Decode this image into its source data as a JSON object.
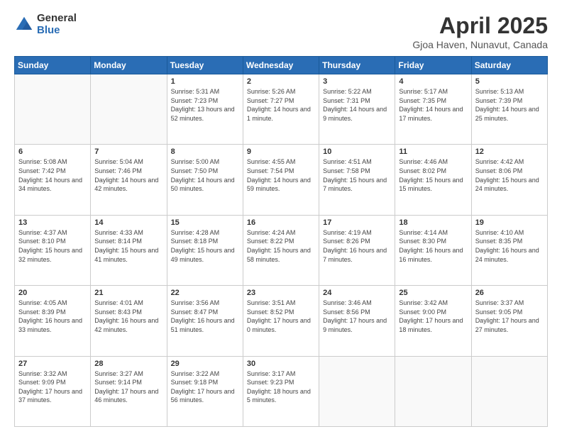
{
  "header": {
    "logo_general": "General",
    "logo_blue": "Blue",
    "title": "April 2025",
    "location": "Gjoa Haven, Nunavut, Canada"
  },
  "days_of_week": [
    "Sunday",
    "Monday",
    "Tuesday",
    "Wednesday",
    "Thursday",
    "Friday",
    "Saturday"
  ],
  "weeks": [
    [
      {
        "day": "",
        "empty": true
      },
      {
        "day": "",
        "empty": true
      },
      {
        "day": "1",
        "sunrise": "Sunrise: 5:31 AM",
        "sunset": "Sunset: 7:23 PM",
        "daylight": "Daylight: 13 hours and 52 minutes."
      },
      {
        "day": "2",
        "sunrise": "Sunrise: 5:26 AM",
        "sunset": "Sunset: 7:27 PM",
        "daylight": "Daylight: 14 hours and 1 minute."
      },
      {
        "day": "3",
        "sunrise": "Sunrise: 5:22 AM",
        "sunset": "Sunset: 7:31 PM",
        "daylight": "Daylight: 14 hours and 9 minutes."
      },
      {
        "day": "4",
        "sunrise": "Sunrise: 5:17 AM",
        "sunset": "Sunset: 7:35 PM",
        "daylight": "Daylight: 14 hours and 17 minutes."
      },
      {
        "day": "5",
        "sunrise": "Sunrise: 5:13 AM",
        "sunset": "Sunset: 7:39 PM",
        "daylight": "Daylight: 14 hours and 25 minutes."
      }
    ],
    [
      {
        "day": "6",
        "sunrise": "Sunrise: 5:08 AM",
        "sunset": "Sunset: 7:42 PM",
        "daylight": "Daylight: 14 hours and 34 minutes."
      },
      {
        "day": "7",
        "sunrise": "Sunrise: 5:04 AM",
        "sunset": "Sunset: 7:46 PM",
        "daylight": "Daylight: 14 hours and 42 minutes."
      },
      {
        "day": "8",
        "sunrise": "Sunrise: 5:00 AM",
        "sunset": "Sunset: 7:50 PM",
        "daylight": "Daylight: 14 hours and 50 minutes."
      },
      {
        "day": "9",
        "sunrise": "Sunrise: 4:55 AM",
        "sunset": "Sunset: 7:54 PM",
        "daylight": "Daylight: 14 hours and 59 minutes."
      },
      {
        "day": "10",
        "sunrise": "Sunrise: 4:51 AM",
        "sunset": "Sunset: 7:58 PM",
        "daylight": "Daylight: 15 hours and 7 minutes."
      },
      {
        "day": "11",
        "sunrise": "Sunrise: 4:46 AM",
        "sunset": "Sunset: 8:02 PM",
        "daylight": "Daylight: 15 hours and 15 minutes."
      },
      {
        "day": "12",
        "sunrise": "Sunrise: 4:42 AM",
        "sunset": "Sunset: 8:06 PM",
        "daylight": "Daylight: 15 hours and 24 minutes."
      }
    ],
    [
      {
        "day": "13",
        "sunrise": "Sunrise: 4:37 AM",
        "sunset": "Sunset: 8:10 PM",
        "daylight": "Daylight: 15 hours and 32 minutes."
      },
      {
        "day": "14",
        "sunrise": "Sunrise: 4:33 AM",
        "sunset": "Sunset: 8:14 PM",
        "daylight": "Daylight: 15 hours and 41 minutes."
      },
      {
        "day": "15",
        "sunrise": "Sunrise: 4:28 AM",
        "sunset": "Sunset: 8:18 PM",
        "daylight": "Daylight: 15 hours and 49 minutes."
      },
      {
        "day": "16",
        "sunrise": "Sunrise: 4:24 AM",
        "sunset": "Sunset: 8:22 PM",
        "daylight": "Daylight: 15 hours and 58 minutes."
      },
      {
        "day": "17",
        "sunrise": "Sunrise: 4:19 AM",
        "sunset": "Sunset: 8:26 PM",
        "daylight": "Daylight: 16 hours and 7 minutes."
      },
      {
        "day": "18",
        "sunrise": "Sunrise: 4:14 AM",
        "sunset": "Sunset: 8:30 PM",
        "daylight": "Daylight: 16 hours and 16 minutes."
      },
      {
        "day": "19",
        "sunrise": "Sunrise: 4:10 AM",
        "sunset": "Sunset: 8:35 PM",
        "daylight": "Daylight: 16 hours and 24 minutes."
      }
    ],
    [
      {
        "day": "20",
        "sunrise": "Sunrise: 4:05 AM",
        "sunset": "Sunset: 8:39 PM",
        "daylight": "Daylight: 16 hours and 33 minutes."
      },
      {
        "day": "21",
        "sunrise": "Sunrise: 4:01 AM",
        "sunset": "Sunset: 8:43 PM",
        "daylight": "Daylight: 16 hours and 42 minutes."
      },
      {
        "day": "22",
        "sunrise": "Sunrise: 3:56 AM",
        "sunset": "Sunset: 8:47 PM",
        "daylight": "Daylight: 16 hours and 51 minutes."
      },
      {
        "day": "23",
        "sunrise": "Sunrise: 3:51 AM",
        "sunset": "Sunset: 8:52 PM",
        "daylight": "Daylight: 17 hours and 0 minutes."
      },
      {
        "day": "24",
        "sunrise": "Sunrise: 3:46 AM",
        "sunset": "Sunset: 8:56 PM",
        "daylight": "Daylight: 17 hours and 9 minutes."
      },
      {
        "day": "25",
        "sunrise": "Sunrise: 3:42 AM",
        "sunset": "Sunset: 9:00 PM",
        "daylight": "Daylight: 17 hours and 18 minutes."
      },
      {
        "day": "26",
        "sunrise": "Sunrise: 3:37 AM",
        "sunset": "Sunset: 9:05 PM",
        "daylight": "Daylight: 17 hours and 27 minutes."
      }
    ],
    [
      {
        "day": "27",
        "sunrise": "Sunrise: 3:32 AM",
        "sunset": "Sunset: 9:09 PM",
        "daylight": "Daylight: 17 hours and 37 minutes."
      },
      {
        "day": "28",
        "sunrise": "Sunrise: 3:27 AM",
        "sunset": "Sunset: 9:14 PM",
        "daylight": "Daylight: 17 hours and 46 minutes."
      },
      {
        "day": "29",
        "sunrise": "Sunrise: 3:22 AM",
        "sunset": "Sunset: 9:18 PM",
        "daylight": "Daylight: 17 hours and 56 minutes."
      },
      {
        "day": "30",
        "sunrise": "Sunrise: 3:17 AM",
        "sunset": "Sunset: 9:23 PM",
        "daylight": "Daylight: 18 hours and 5 minutes."
      },
      {
        "day": "",
        "empty": true
      },
      {
        "day": "",
        "empty": true
      },
      {
        "day": "",
        "empty": true
      }
    ]
  ]
}
